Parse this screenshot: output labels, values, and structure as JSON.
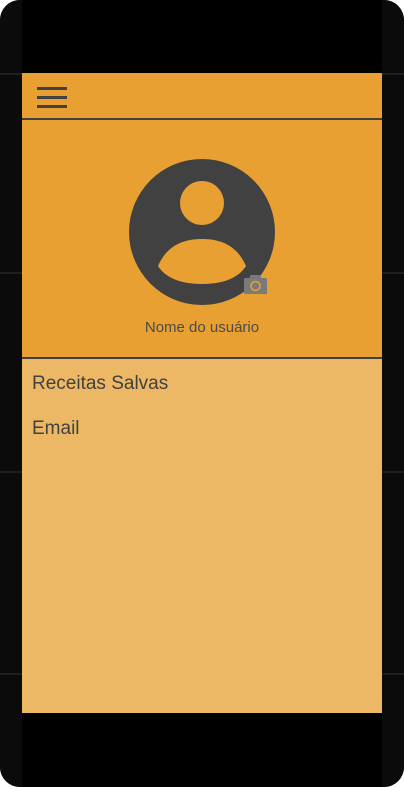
{
  "profile": {
    "username": "Nome do usuário"
  },
  "menu": {
    "items": [
      {
        "label": "Receitas Salvas"
      },
      {
        "label": "Email"
      }
    ]
  },
  "icons": {
    "menu": "hamburger-menu-icon",
    "avatar": "user-avatar-icon",
    "camera": "camera-icon"
  },
  "colors": {
    "toolbar": "#e8a033",
    "content": "#edb865",
    "dark": "#414141"
  }
}
